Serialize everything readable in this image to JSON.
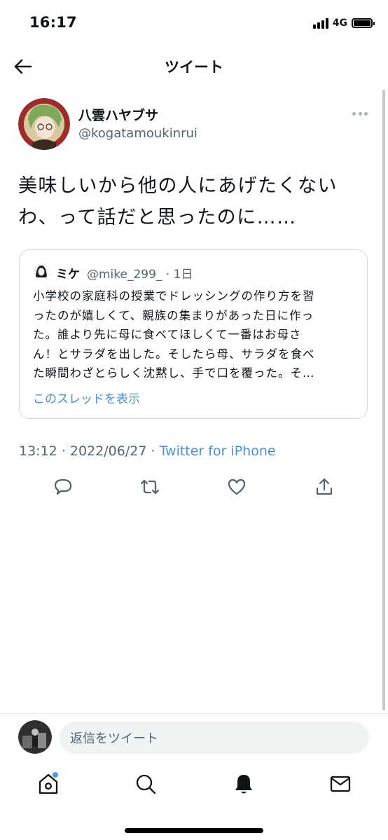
{
  "status_bar": {
    "time": "16:17",
    "network": "4G"
  },
  "header": {
    "title": "ツイート"
  },
  "tweet": {
    "author_name": "八雲ハヤブサ",
    "author_handle": "@kogatamoukinrui",
    "text_lines": [
      "美味しいから他の人にあげたくない",
      "わ、って話だと思ったのに……"
    ],
    "time": "13:12",
    "date": "2022/06/27",
    "separator": "·",
    "source": "Twitter for iPhone"
  },
  "quote": {
    "author_name": "ミケ",
    "author_handle_meta": "@mike_299_ · 1日",
    "lines": [
      "小学校の家庭科の授業でドレッシングの作り方を習",
      "ったのが嬉しくて、親族の集まりがあった日に作っ",
      "た。誰より先に母に食べてほしくて一番はお母さ",
      "ん！とサラダを出した。そしたら母、サラダを食べ",
      "た瞬間わざとらしく沈黙し、手で口を覆った。そ…"
    ],
    "show_thread": "このスレッドを表示"
  },
  "reply": {
    "placeholder": "返信をツイート"
  },
  "icons": {
    "back": "arrow-left-icon",
    "reply": "reply-icon",
    "retweet": "retweet-icon",
    "like": "heart-icon",
    "share": "share-icon",
    "home": "home-icon",
    "search": "search-icon",
    "notifications": "bell-icon",
    "messages": "mail-icon"
  },
  "colors": {
    "link": "#4b8fd0",
    "secondary_text": "#536471",
    "notification_dot": "#4b9ce8"
  }
}
